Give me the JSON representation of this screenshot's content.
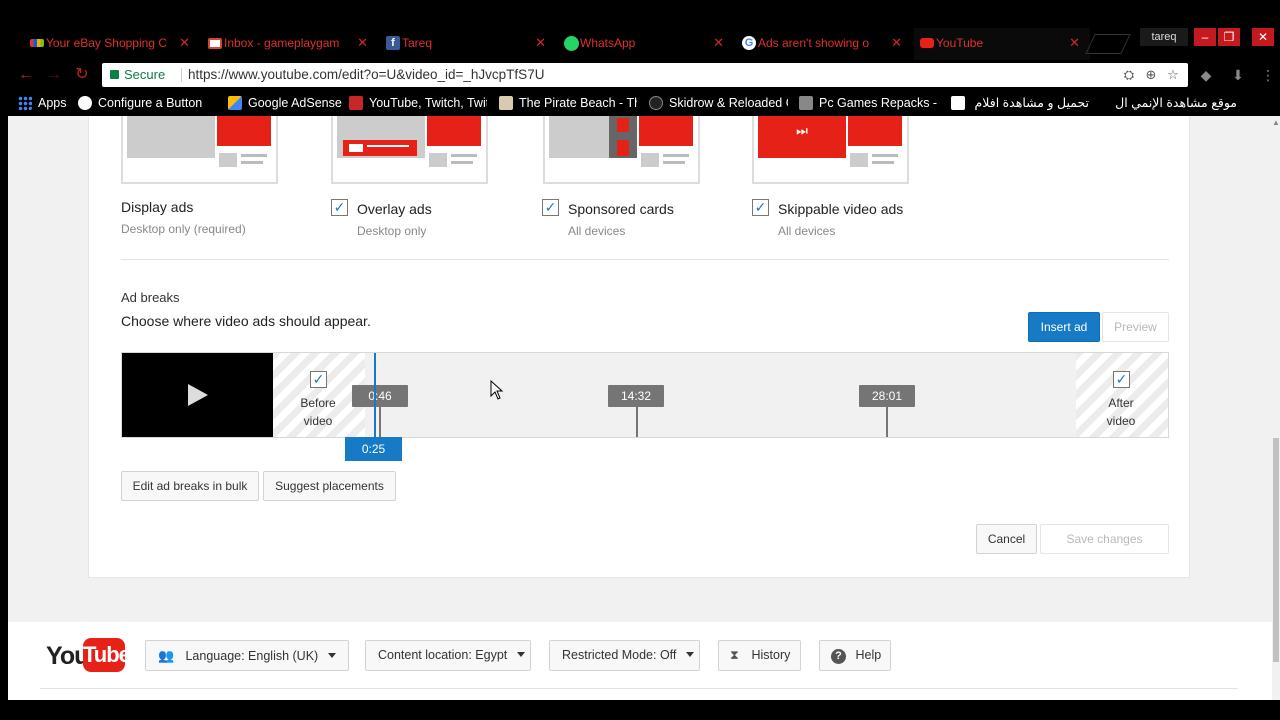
{
  "tabs": [
    {
      "title": "Your eBay Shopping C",
      "icon": "ebay-icon",
      "color": "#e53238"
    },
    {
      "title": "Inbox - gameplaygam",
      "icon": "gmail-icon",
      "color": "#d44638"
    },
    {
      "title": "Tareq",
      "icon": "facebook-icon",
      "color": "#3b5998"
    },
    {
      "title": "WhatsApp",
      "icon": "whatsapp-icon",
      "color": "#25d366"
    },
    {
      "title": "Ads aren't showing o",
      "icon": "google-icon",
      "color": "#4285f4"
    },
    {
      "title": "YouTube",
      "icon": "youtube-icon",
      "color": "#e62117"
    }
  ],
  "profile_name": "tareq",
  "address": {
    "secure_label": "Secure",
    "url": "https://www.youtube.com/edit?o=U&video_id=_hJvcpTfS7U"
  },
  "bookmarks": [
    {
      "label": "Apps",
      "icon": "apps-grid-icon"
    },
    {
      "label": "Configure a Button",
      "icon": "configure-icon"
    },
    {
      "label": "Google AdSense",
      "icon": "adsense-icon"
    },
    {
      "label": "YouTube, Twitch, Twitt",
      "icon": "chart-icon"
    },
    {
      "label": "The Pirate Beach - The",
      "icon": "pirate-icon"
    },
    {
      "label": "Skidrow & Reloaded G",
      "icon": "skidrow-icon"
    },
    {
      "label": "Pc Games Repacks - R",
      "icon": "repack-icon"
    },
    {
      "label": "تحميل و مشاهدة افلام",
      "icon": "site-icon"
    },
    {
      "label": "موقع مشاهدة الإنمي ال",
      "icon": "bookmark-icon"
    }
  ],
  "ad_types": [
    {
      "label": "Display ads",
      "sub": "Desktop only (required)",
      "checkbox": false
    },
    {
      "label": "Overlay ads",
      "sub": "Desktop only",
      "checkbox": true
    },
    {
      "label": "Sponsored cards",
      "sub": "All devices",
      "checkbox": true
    },
    {
      "label": "Skippable video ads",
      "sub": "All devices",
      "checkbox": true
    }
  ],
  "ad_breaks": {
    "title": "Ad breaks",
    "description": "Choose where video ads should appear.",
    "insert_label": "Insert ad",
    "preview_label": "Preview",
    "before_label_1": "Before",
    "before_label_2": "video",
    "after_label_1": "After",
    "after_label_2": "video",
    "markers": [
      "0:46",
      "14:32",
      "28:01"
    ],
    "playhead": "0:25",
    "bulk_label": "Edit ad breaks in bulk",
    "suggest_label": "Suggest placements",
    "cancel_label": "Cancel",
    "save_label": "Save changes"
  },
  "footer": {
    "logo_you": "You",
    "logo_tube": "Tube",
    "language": "Language: English (UK)",
    "location": "Content location: Egypt",
    "restricted": "Restricted Mode: Off",
    "history": "History",
    "help": "Help"
  },
  "colors": {
    "accent_blue": "#167ac6",
    "youtube_red": "#e62117",
    "tab_text_red": "#e03030"
  }
}
